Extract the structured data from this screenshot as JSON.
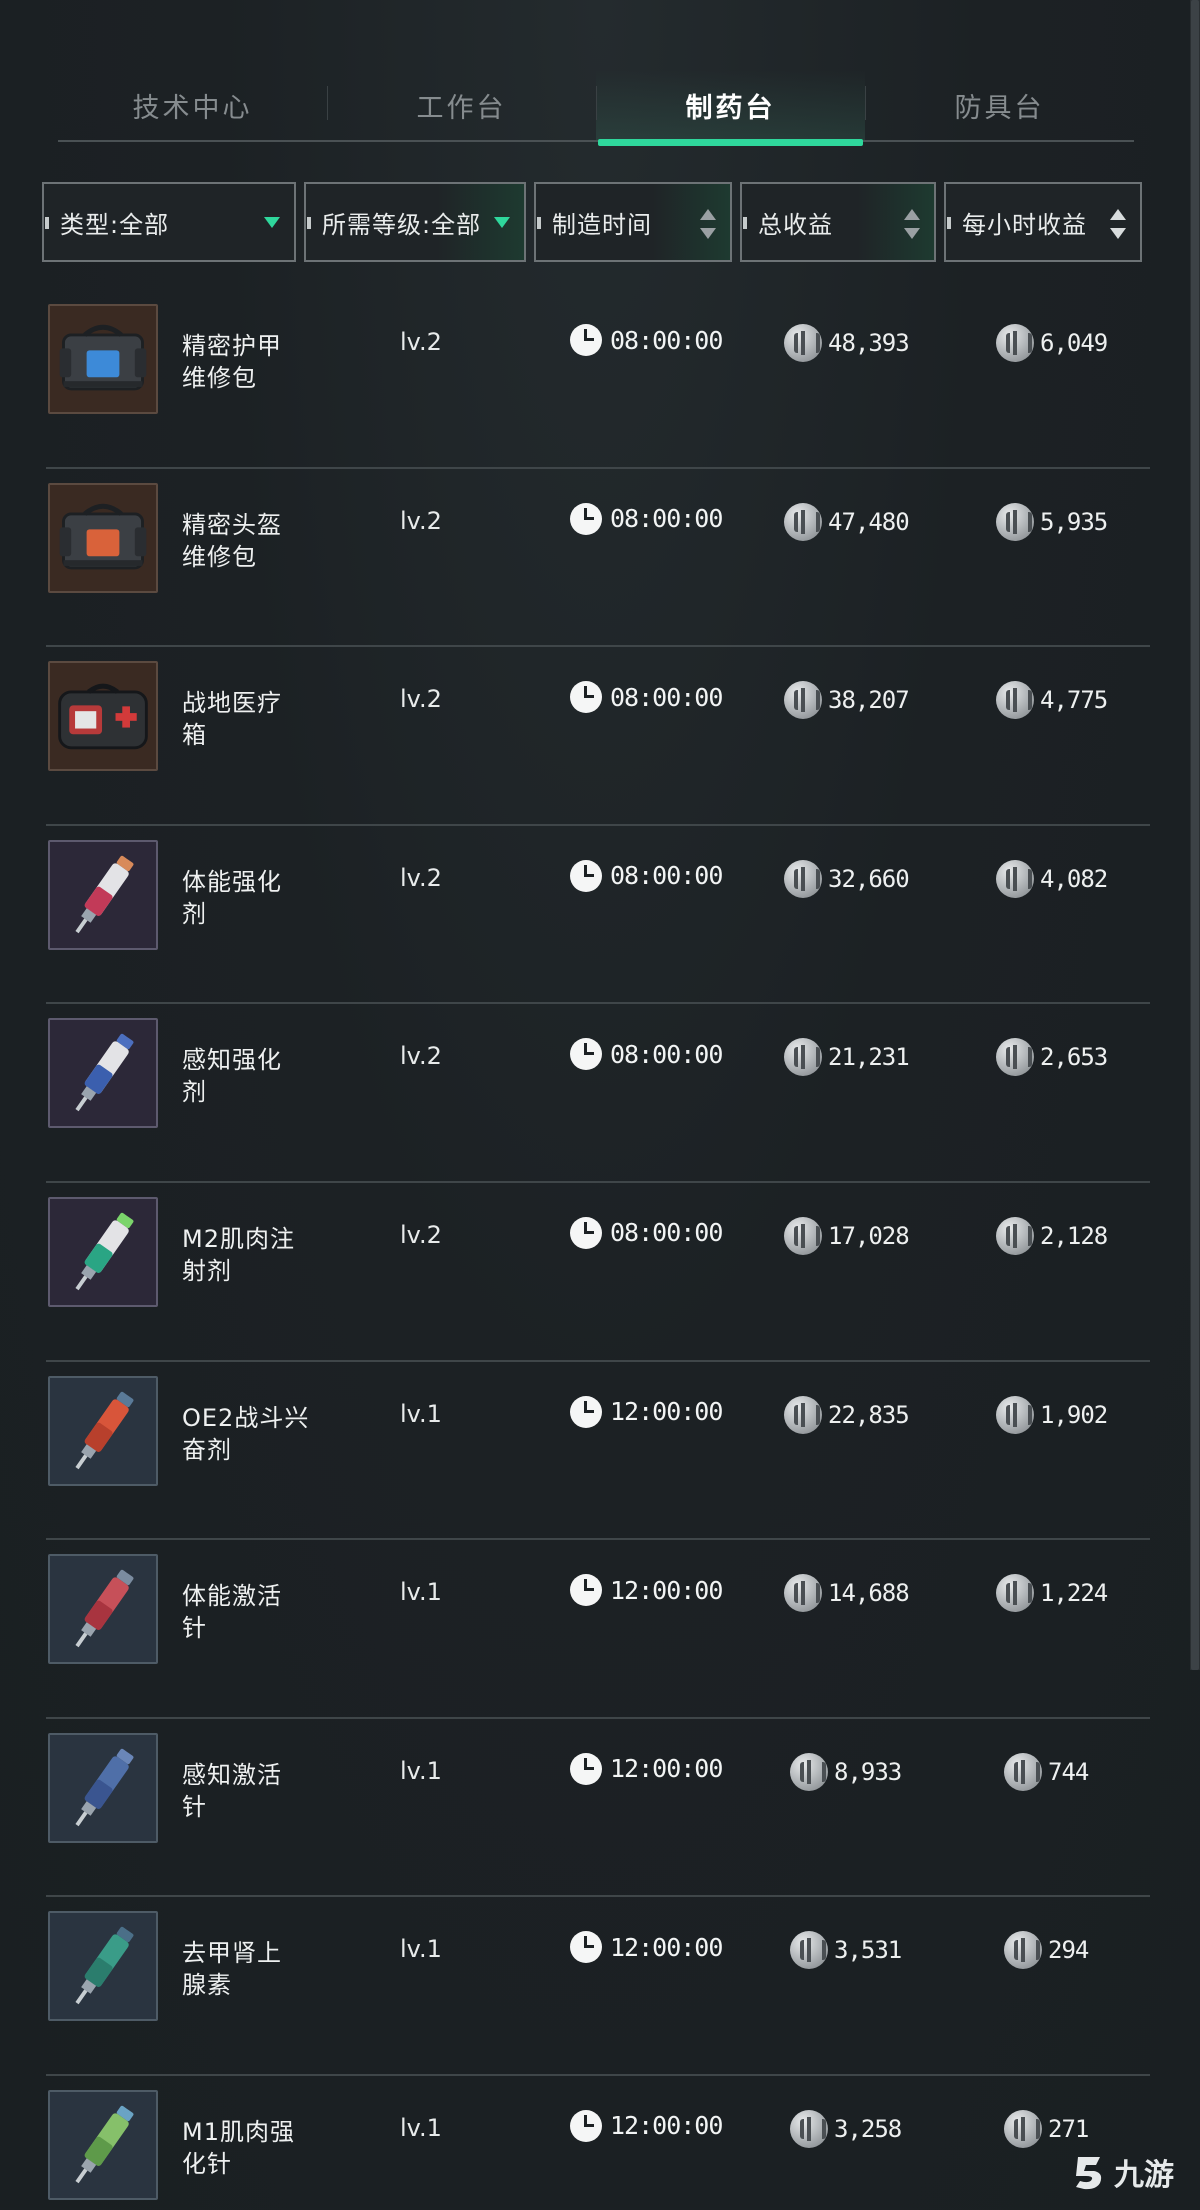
{
  "tabs": [
    {
      "label": "技术中心",
      "active": false
    },
    {
      "label": "工作台",
      "active": false
    },
    {
      "label": "制药台",
      "active": true
    },
    {
      "label": "防具台",
      "active": false
    }
  ],
  "filters": {
    "type_label": "类型:全部",
    "level_label": "所需等级:全部",
    "time_label": "制造时间",
    "total_label": "总收益",
    "hourly_label": "每小时收益"
  },
  "items": [
    {
      "name_line1": "精密护甲",
      "name_line2": "维修包",
      "level": "lv.2",
      "time": "08:00:00",
      "total": "48,393",
      "hourly": "6,049",
      "icon": "armor-repair-kit-icon"
    },
    {
      "name_line1": "精密头盔",
      "name_line2": "维修包",
      "level": "lv.2",
      "time": "08:00:00",
      "total": "47,480",
      "hourly": "5,935",
      "icon": "helmet-repair-kit-icon"
    },
    {
      "name_line1": "战地医疗",
      "name_line2": "箱",
      "level": "lv.2",
      "time": "08:00:00",
      "total": "38,207",
      "hourly": "4,775",
      "icon": "medical-kit-icon"
    },
    {
      "name_line1": "体能强化",
      "name_line2": "剂",
      "level": "lv.2",
      "time": "08:00:00",
      "total": "32,660",
      "hourly": "4,082",
      "icon": "stamina-injector-icon"
    },
    {
      "name_line1": "感知强化",
      "name_line2": "剂",
      "level": "lv.2",
      "time": "08:00:00",
      "total": "21,231",
      "hourly": "2,653",
      "icon": "perception-injector-icon"
    },
    {
      "name_line1": "M2肌肉注",
      "name_line2": "射剂",
      "level": "lv.2",
      "time": "08:00:00",
      "total": "17,028",
      "hourly": "2,128",
      "icon": "muscle-injector-icon"
    },
    {
      "name_line1": "OE2战斗兴",
      "name_line2": "奋剂",
      "level": "lv.1",
      "time": "12:00:00",
      "total": "22,835",
      "hourly": "1,902",
      "icon": "combat-stimulant-icon"
    },
    {
      "name_line1": "体能激活",
      "name_line2": "针",
      "level": "lv.1",
      "time": "12:00:00",
      "total": "14,688",
      "hourly": "1,224",
      "icon": "stamina-activator-icon"
    },
    {
      "name_line1": "感知激活",
      "name_line2": "针",
      "level": "lv.1",
      "time": "12:00:00",
      "total": "8,933",
      "hourly": "744",
      "icon": "perception-activator-icon"
    },
    {
      "name_line1": "去甲肾上",
      "name_line2": "腺素",
      "level": "lv.1",
      "time": "12:00:00",
      "total": "3,531",
      "hourly": "294",
      "icon": "norepinephrine-icon"
    },
    {
      "name_line1": "M1肌肉强",
      "name_line2": "化针",
      "level": "lv.1",
      "time": "12:00:00",
      "total": "3,258",
      "hourly": "271",
      "icon": "muscle-booster-icon"
    }
  ],
  "watermark": {
    "text": "九游"
  },
  "colors": {
    "accent": "#2fd79c",
    "background": "#1c2124",
    "divider": "#3f4649"
  }
}
